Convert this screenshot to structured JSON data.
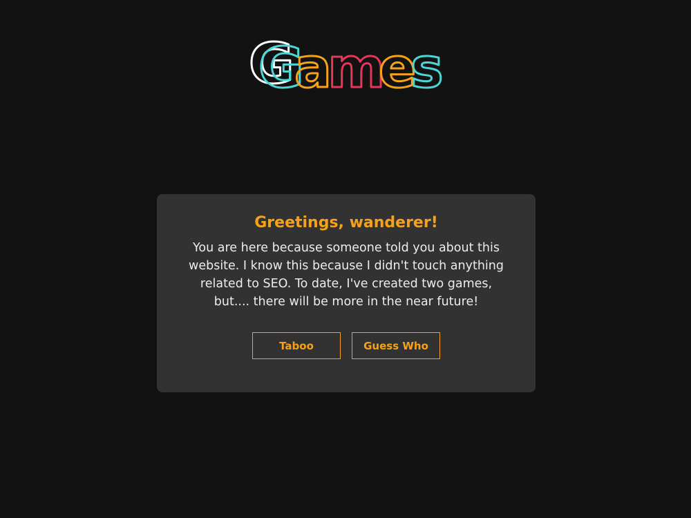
{
  "logo": {
    "text": "Games",
    "letters": [
      "G",
      "a",
      "m",
      "e",
      "s"
    ],
    "colors": [
      "#f5a21a",
      "#f5a21a",
      "#4ad6d6",
      "#e8365a",
      "#f5a21a",
      "#4ad6d6",
      "#ffffff"
    ]
  },
  "card": {
    "title": "Greetings, wanderer!",
    "text": "You are here because someone told you about this website. I know this because I didn't touch anything related to SEO. To date, I've created two games, but.... there will be more in the near future!",
    "buttons": [
      {
        "label": "Taboo"
      },
      {
        "label": "Guess Who"
      }
    ]
  },
  "colors": {
    "background": "#121212",
    "card": "#323232",
    "accent": "#f5a21a",
    "text": "#ececec"
  }
}
